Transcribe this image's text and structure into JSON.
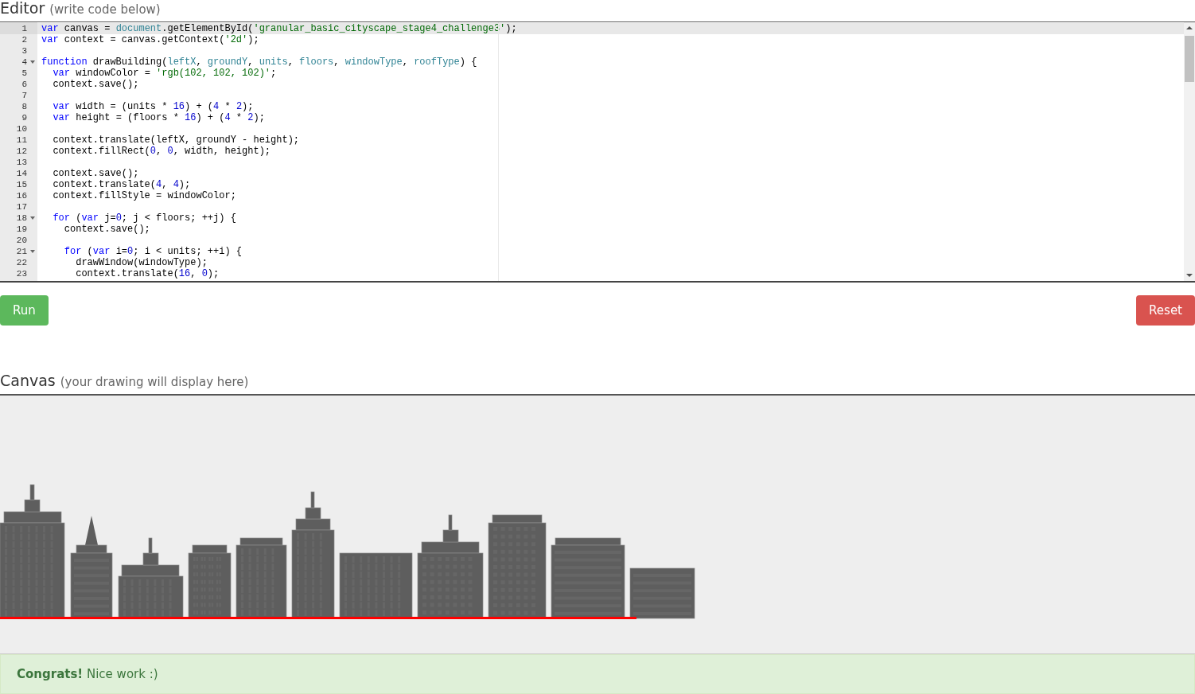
{
  "editor": {
    "title": "Editor",
    "subtitle": "(write code below)",
    "lines": [
      {
        "number": "1",
        "active": true,
        "fold": false,
        "segments": [
          {
            "kind": "kw",
            "text": "var"
          },
          {
            "kind": "tx",
            "text": " canvas = "
          },
          {
            "kind": "id",
            "text": "document"
          },
          {
            "kind": "tx",
            "text": ".getElementById("
          },
          {
            "kind": "str",
            "text": "'granular_basic_cityscape_stage4_challenge3'"
          },
          {
            "kind": "tx",
            "text": ");"
          }
        ]
      },
      {
        "number": "2",
        "active": false,
        "fold": false,
        "segments": [
          {
            "kind": "kw",
            "text": "var"
          },
          {
            "kind": "tx",
            "text": " context = canvas.getContext("
          },
          {
            "kind": "str",
            "text": "'2d'"
          },
          {
            "kind": "tx",
            "text": ");"
          }
        ]
      },
      {
        "number": "3",
        "active": false,
        "fold": false
      },
      {
        "number": "4",
        "active": false,
        "fold": true,
        "segments": [
          {
            "kind": "kw",
            "text": "function"
          },
          {
            "kind": "tx",
            "text": " drawBuilding("
          },
          {
            "kind": "id",
            "text": "leftX"
          },
          {
            "kind": "tx",
            "text": ", "
          },
          {
            "kind": "id",
            "text": "groundY"
          },
          {
            "kind": "tx",
            "text": ", "
          },
          {
            "kind": "id",
            "text": "units"
          },
          {
            "kind": "tx",
            "text": ", "
          },
          {
            "kind": "id",
            "text": "floors"
          },
          {
            "kind": "tx",
            "text": ", "
          },
          {
            "kind": "id",
            "text": "windowType"
          },
          {
            "kind": "tx",
            "text": ", "
          },
          {
            "kind": "id",
            "text": "roofType"
          },
          {
            "kind": "tx",
            "text": ") {"
          }
        ]
      },
      {
        "number": "5",
        "active": false,
        "fold": false,
        "segments": [
          {
            "kind": "kw",
            "text": "  var"
          },
          {
            "kind": "tx",
            "text": " windowColor = "
          },
          {
            "kind": "str",
            "text": "'rgb(102, 102, 102)'"
          },
          {
            "kind": "tx",
            "text": ";"
          }
        ]
      },
      {
        "number": "6",
        "active": false,
        "fold": false,
        "segments": [
          {
            "kind": "tx",
            "text": "  context.save();"
          }
        ]
      },
      {
        "number": "7",
        "active": false,
        "fold": false
      },
      {
        "number": "8",
        "active": false,
        "fold": false,
        "segments": [
          {
            "kind": "kw",
            "text": "  var"
          },
          {
            "kind": "tx",
            "text": " width = (units * "
          },
          {
            "kind": "num",
            "text": "16"
          },
          {
            "kind": "tx",
            "text": ") + ("
          },
          {
            "kind": "num",
            "text": "4"
          },
          {
            "kind": "tx",
            "text": " * "
          },
          {
            "kind": "num",
            "text": "2"
          },
          {
            "kind": "tx",
            "text": ");"
          }
        ]
      },
      {
        "number": "9",
        "active": false,
        "fold": false,
        "segments": [
          {
            "kind": "kw",
            "text": "  var"
          },
          {
            "kind": "tx",
            "text": " height = (floors * "
          },
          {
            "kind": "num",
            "text": "16"
          },
          {
            "kind": "tx",
            "text": ") + ("
          },
          {
            "kind": "num",
            "text": "4"
          },
          {
            "kind": "tx",
            "text": " * "
          },
          {
            "kind": "num",
            "text": "2"
          },
          {
            "kind": "tx",
            "text": ");"
          }
        ]
      },
      {
        "number": "10",
        "active": false,
        "fold": false
      },
      {
        "number": "11",
        "active": false,
        "fold": false,
        "segments": [
          {
            "kind": "tx",
            "text": "  context.translate(leftX, groundY - height);"
          }
        ]
      },
      {
        "number": "12",
        "active": false,
        "fold": false,
        "segments": [
          {
            "kind": "tx",
            "text": "  context.fillRect("
          },
          {
            "kind": "num",
            "text": "0"
          },
          {
            "kind": "tx",
            "text": ", "
          },
          {
            "kind": "num",
            "text": "0"
          },
          {
            "kind": "tx",
            "text": ", width, height);"
          }
        ]
      },
      {
        "number": "13",
        "active": false,
        "fold": false
      },
      {
        "number": "14",
        "active": false,
        "fold": false,
        "segments": [
          {
            "kind": "tx",
            "text": "  context.save();"
          }
        ]
      },
      {
        "number": "15",
        "active": false,
        "fold": false,
        "segments": [
          {
            "kind": "tx",
            "text": "  context.translate("
          },
          {
            "kind": "num",
            "text": "4"
          },
          {
            "kind": "tx",
            "text": ", "
          },
          {
            "kind": "num",
            "text": "4"
          },
          {
            "kind": "tx",
            "text": ");"
          }
        ]
      },
      {
        "number": "16",
        "active": false,
        "fold": false,
        "segments": [
          {
            "kind": "tx",
            "text": "  context.fillStyle = windowColor;"
          }
        ]
      },
      {
        "number": "17",
        "active": false,
        "fold": false
      },
      {
        "number": "18",
        "active": false,
        "fold": true,
        "segments": [
          {
            "kind": "kw",
            "text": "  for"
          },
          {
            "kind": "tx",
            "text": " ("
          },
          {
            "kind": "kw",
            "text": "var"
          },
          {
            "kind": "tx",
            "text": " j="
          },
          {
            "kind": "num",
            "text": "0"
          },
          {
            "kind": "tx",
            "text": "; j < floors; ++j) {"
          }
        ]
      },
      {
        "number": "19",
        "active": false,
        "fold": false,
        "segments": [
          {
            "kind": "tx",
            "text": "    context.save();"
          }
        ]
      },
      {
        "number": "20",
        "active": false,
        "fold": false
      },
      {
        "number": "21",
        "active": false,
        "fold": true,
        "segments": [
          {
            "kind": "kw",
            "text": "    for"
          },
          {
            "kind": "tx",
            "text": " ("
          },
          {
            "kind": "kw",
            "text": "var"
          },
          {
            "kind": "tx",
            "text": " i="
          },
          {
            "kind": "num",
            "text": "0"
          },
          {
            "kind": "tx",
            "text": "; i < units; ++i) {"
          }
        ]
      },
      {
        "number": "22",
        "active": false,
        "fold": false,
        "segments": [
          {
            "kind": "tx",
            "text": "      drawWindow(windowType);"
          }
        ]
      },
      {
        "number": "23",
        "active": false,
        "fold": false,
        "segments": [
          {
            "kind": "tx",
            "text": "      context.translate("
          },
          {
            "kind": "num",
            "text": "16"
          },
          {
            "kind": "tx",
            "text": ", "
          },
          {
            "kind": "num",
            "text": "0"
          },
          {
            "kind": "tx",
            "text": ");"
          }
        ]
      }
    ]
  },
  "buttons": [
    {
      "label": "Run",
      "kind": "run"
    },
    {
      "label": "Reset",
      "kind": "reset"
    }
  ],
  "canvas": {
    "title": "Canvas",
    "subtitle": "(your drawing will display here)"
  },
  "alert": {
    "strong": "Congrats!",
    "text": "Nice work :)"
  }
}
